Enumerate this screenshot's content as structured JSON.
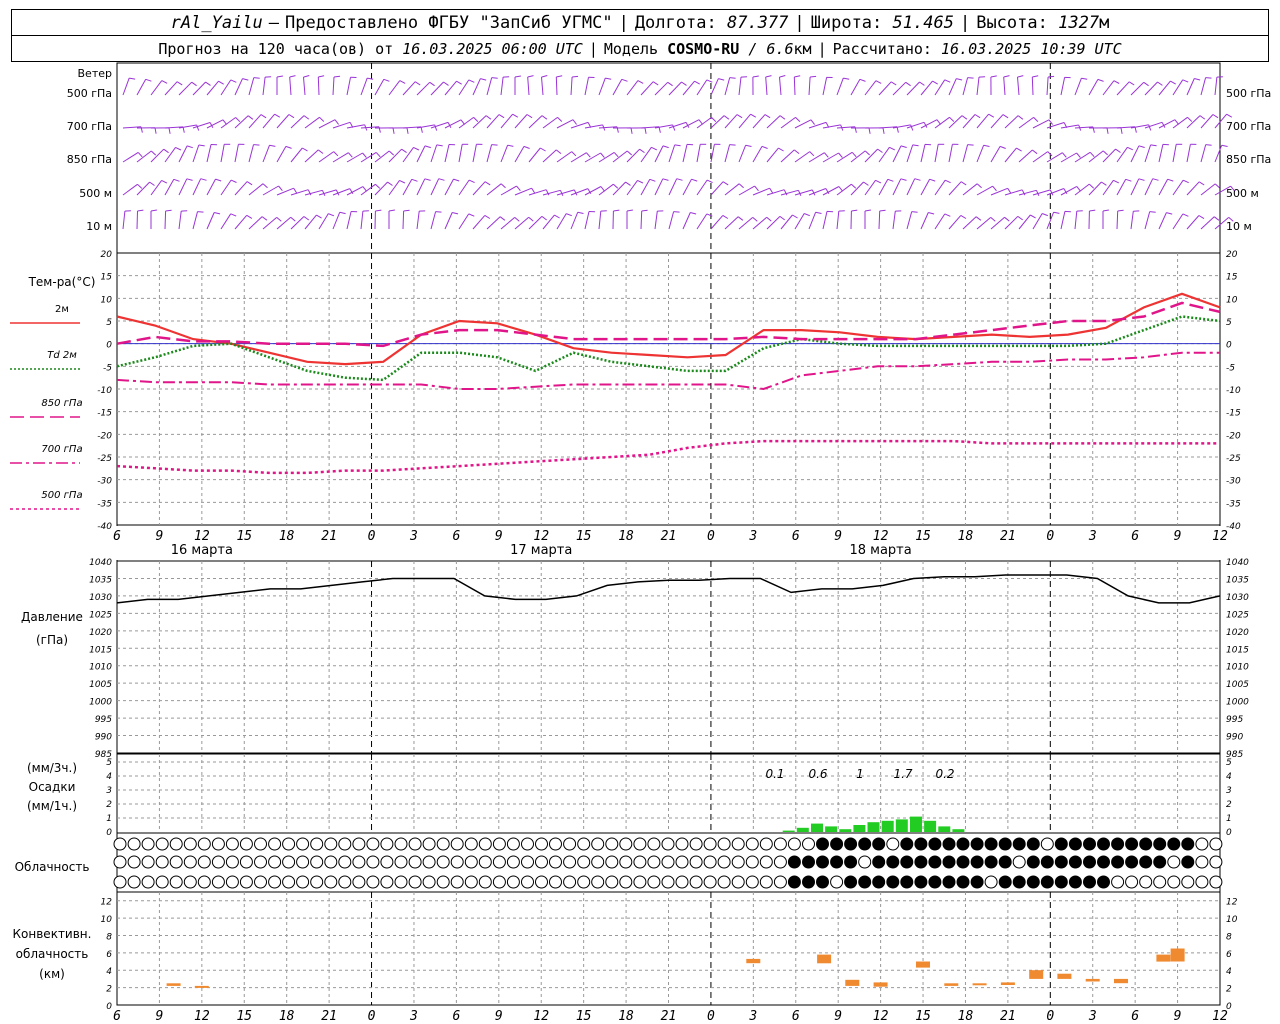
{
  "header": {
    "station": "rAl_Yailu",
    "dash": "–",
    "provider": "Предоставлено ФГБУ \"ЗапСиб УГМС\"",
    "lon_label": "Долгота:",
    "lon": "87.377",
    "lat_label": "Широта:",
    "lat": "51.465",
    "alt_label": "Высота:",
    "alt": "1327",
    "alt_unit": "м",
    "forecast_label": "Прогноз на 120 часа(ов) от",
    "forecast_from": "16.03.2025 06:00 UTC",
    "model_label": "Модель",
    "model": "COSMO-RU",
    "resolution": "/ 6.6",
    "res_unit": "км",
    "calc_label": "Рассчитано:",
    "calc_time": "16.03.2025 10:39 UTC"
  },
  "colors": {
    "wind": "#9a33d6",
    "t2m": "#ee3333",
    "td2m": "#1a8a1a",
    "t850": "#e0158a",
    "t700": "#e0158a",
    "t500": "#e0158a",
    "pressure": "#000000",
    "precip": "#22cc22",
    "convective": "#f08a30",
    "zero_line": "#3333cc",
    "grid": "#999999"
  },
  "x_axis": {
    "ticks": [
      "6",
      "9",
      "12",
      "15",
      "18",
      "21",
      "0",
      "3",
      "6",
      "9",
      "12",
      "15",
      "18",
      "21",
      "0",
      "3",
      "6",
      "9",
      "12",
      "15",
      "18",
      "21",
      "0",
      "3",
      "6",
      "9",
      "12"
    ],
    "days": [
      "16 марта",
      "17 марта",
      "18 марта"
    ]
  },
  "wind_panel": {
    "labels": [
      "Ветер",
      "500 гПа",
      "700 гПа",
      "850 гПа",
      "500 м",
      "10 м"
    ],
    "right_labels": [
      "500 гПа",
      "700 гПа",
      "850 гПа",
      "500 м",
      "10 м"
    ]
  },
  "temp_panel": {
    "title": "Тем-ра(°C)",
    "legend": [
      {
        "label": "2м",
        "style": "solid"
      },
      {
        "label": "Td 2м",
        "style": "dotted"
      },
      {
        "label": "850 гПа",
        "style": "longdash"
      },
      {
        "label": "700 гПа",
        "style": "dashdot"
      },
      {
        "label": "500 гПа",
        "style": "dash"
      }
    ]
  },
  "pressure_panel": {
    "label": "Давление",
    "unit": "(гПа)"
  },
  "precip_panel": {
    "unit_top": "(мм/3ч.)",
    "label": "Осадки",
    "unit_bottom": "(мм/1ч.)",
    "annotations": [
      "0.1",
      "0.6",
      "1",
      "1.7",
      "0.2"
    ]
  },
  "cloud_panel": {
    "label": "Облачность"
  },
  "conv_panel": {
    "label1": "Конвективн.",
    "label2": "облачность",
    "unit": "(км)"
  },
  "chart_data": [
    {
      "type": "line",
      "title": "Тем-ра(°C)",
      "ylim": [
        -40,
        20
      ],
      "yticks": [
        20,
        15,
        10,
        5,
        0,
        -5,
        -10,
        -15,
        -20,
        -25,
        -30,
        -35,
        -40
      ],
      "x_hours": [
        0,
        3,
        6,
        9,
        12,
        15,
        18,
        21,
        24,
        27,
        30,
        33,
        36,
        39,
        42,
        45,
        48,
        51,
        54,
        57,
        60,
        63,
        66,
        69,
        72,
        75,
        78
      ],
      "series": [
        {
          "name": "2м",
          "values": [
            6,
            4,
            1,
            0,
            -2,
            -4,
            -4.5,
            -4,
            2,
            5,
            4.5,
            2,
            -1,
            -2,
            -2.5,
            -3,
            -2.5,
            3,
            3,
            2.5,
            1.5,
            1,
            1.5,
            2,
            1.5,
            2,
            3.5,
            8,
            11,
            8
          ]
        },
        {
          "name": "Td 2м",
          "values": [
            -5,
            -3,
            -0.5,
            0,
            -3,
            -6,
            -7.5,
            -8,
            -2,
            -2,
            -3,
            -6,
            -2,
            -4,
            -5,
            -6,
            -6,
            -1,
            1,
            0,
            -0.5,
            -0.5,
            -0.5,
            -0.5,
            -0.5,
            -0.5,
            0,
            3,
            6,
            5
          ]
        },
        {
          "name": "850 гПа",
          "values": [
            0,
            1.5,
            0.5,
            0.5,
            0,
            0,
            0,
            -0.5,
            2,
            3,
            3,
            2,
            1,
            1,
            1,
            1,
            1,
            1.5,
            1,
            1,
            1,
            1,
            2,
            3,
            4,
            5,
            5,
            6,
            9,
            7
          ]
        },
        {
          "name": "700 гПа",
          "values": [
            -8,
            -8.5,
            -8.5,
            -8.5,
            -9,
            -9,
            -9,
            -9,
            -9,
            -10,
            -10,
            -9.5,
            -9,
            -9,
            -9,
            -9,
            -9,
            -10,
            -7,
            -6,
            -5,
            -5,
            -4.5,
            -4,
            -4,
            -3.5,
            -3.5,
            -3,
            -2,
            -2
          ]
        },
        {
          "name": "500 гПа",
          "values": [
            -27,
            -27.5,
            -28,
            -28,
            -28.5,
            -28.5,
            -28,
            -28,
            -27.5,
            -27,
            -26.5,
            -26,
            -25.5,
            -25,
            -24.5,
            -23,
            -22,
            -21.5,
            -21.5,
            -21.5,
            -21.5,
            -21.5,
            -21.5,
            -22,
            -22,
            -22,
            -22,
            -22,
            -22,
            -22
          ]
        }
      ]
    },
    {
      "type": "line",
      "title": "Давление",
      "ylim": [
        985,
        1040
      ],
      "yticks": [
        1040,
        1035,
        1030,
        1025,
        1020,
        1015,
        1010,
        1005,
        1000,
        995,
        990,
        985
      ],
      "series": [
        {
          "name": "Давление",
          "values": [
            1028,
            1029,
            1029,
            1030,
            1031,
            1032,
            1032,
            1033,
            1034,
            1035,
            1035,
            1035,
            1030,
            1029,
            1029,
            1030,
            1033,
            1034,
            1034.5,
            1034.5,
            1035,
            1035,
            1031,
            1032,
            1032,
            1033,
            1035,
            1035.5,
            1035.5,
            1036,
            1036,
            1036,
            1035,
            1030,
            1028,
            1028,
            1030
          ]
        }
      ]
    },
    {
      "type": "bar",
      "title": "Осадки",
      "ylim": [
        0,
        5
      ],
      "yticks": [
        5,
        4,
        3,
        2,
        1,
        0
      ],
      "annotations": [
        "0.1",
        "0.6",
        "1",
        "1.7",
        "0.2"
      ],
      "series": [
        {
          "name": "Осадки",
          "values": [
            0.1,
            0.3,
            0.6,
            0.4,
            0.2,
            0.5,
            0.7,
            0.8,
            0.9,
            1.1,
            0.8,
            0.4,
            0.2
          ]
        }
      ]
    },
    {
      "type": "bar",
      "title": "Конвективн. облачность",
      "ylim": [
        0,
        13
      ],
      "yticks": [
        12,
        10,
        8,
        6,
        4,
        2,
        0
      ],
      "series": [
        {
          "name": "Конвективн. облачность",
          "values": [
            {
              "x": 4,
              "base": 2.2,
              "top": 2.5
            },
            {
              "x": 6,
              "base": 2.0,
              "top": 2.2
            },
            {
              "x": 45,
              "base": 4.8,
              "top": 5.3
            },
            {
              "x": 50,
              "base": 4.8,
              "top": 5.8
            },
            {
              "x": 52,
              "base": 2.2,
              "top": 2.9
            },
            {
              "x": 54,
              "base": 2.1,
              "top": 2.6
            },
            {
              "x": 57,
              "base": 4.3,
              "top": 5.0
            },
            {
              "x": 59,
              "base": 2.2,
              "top": 2.5
            },
            {
              "x": 61,
              "base": 2.3,
              "top": 2.5
            },
            {
              "x": 63,
              "base": 2.3,
              "top": 2.6
            },
            {
              "x": 65,
              "base": 3.0,
              "top": 4.0
            },
            {
              "x": 67,
              "base": 3.0,
              "top": 3.6
            },
            {
              "x": 69,
              "base": 2.7,
              "top": 3.0
            },
            {
              "x": 71,
              "base": 2.5,
              "top": 3.0
            },
            {
              "x": 74,
              "base": 5.0,
              "top": 5.8
            },
            {
              "x": 75,
              "base": 5.0,
              "top": 6.5
            }
          ]
        }
      ]
    }
  ]
}
